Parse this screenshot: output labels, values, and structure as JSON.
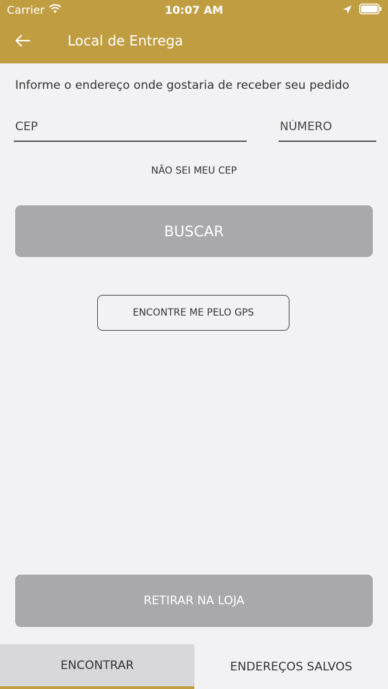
{
  "status_bar": {
    "carrier": "Carrier",
    "time": "10:07 AM"
  },
  "app_bar": {
    "title": "Local de Entrega"
  },
  "content": {
    "intro": "Informe o endereço onde gostaria de receber seu pedido",
    "cep_placeholder": "CEP",
    "numero_placeholder": "NÚMERO",
    "dont_know_cep": "NÃO SEI MEU CEP",
    "search_label": "BUSCAR",
    "gps_label": "ENCONTRE ME PELO GPS",
    "pickup_label": "RETIRAR NA LOJA"
  },
  "tabs": [
    {
      "label": "ENCONTRAR",
      "active": true
    },
    {
      "label": "ENDEREÇOS SALVOS",
      "active": false
    }
  ],
  "colors": {
    "brand": "#c19d42",
    "background": "#f2f2f4",
    "disabled_button": "#a9a8aa",
    "active_tab": "#d8d8da"
  },
  "icons": [
    "wifi-icon",
    "location-arrow-icon",
    "battery-icon",
    "back-arrow-icon"
  ]
}
